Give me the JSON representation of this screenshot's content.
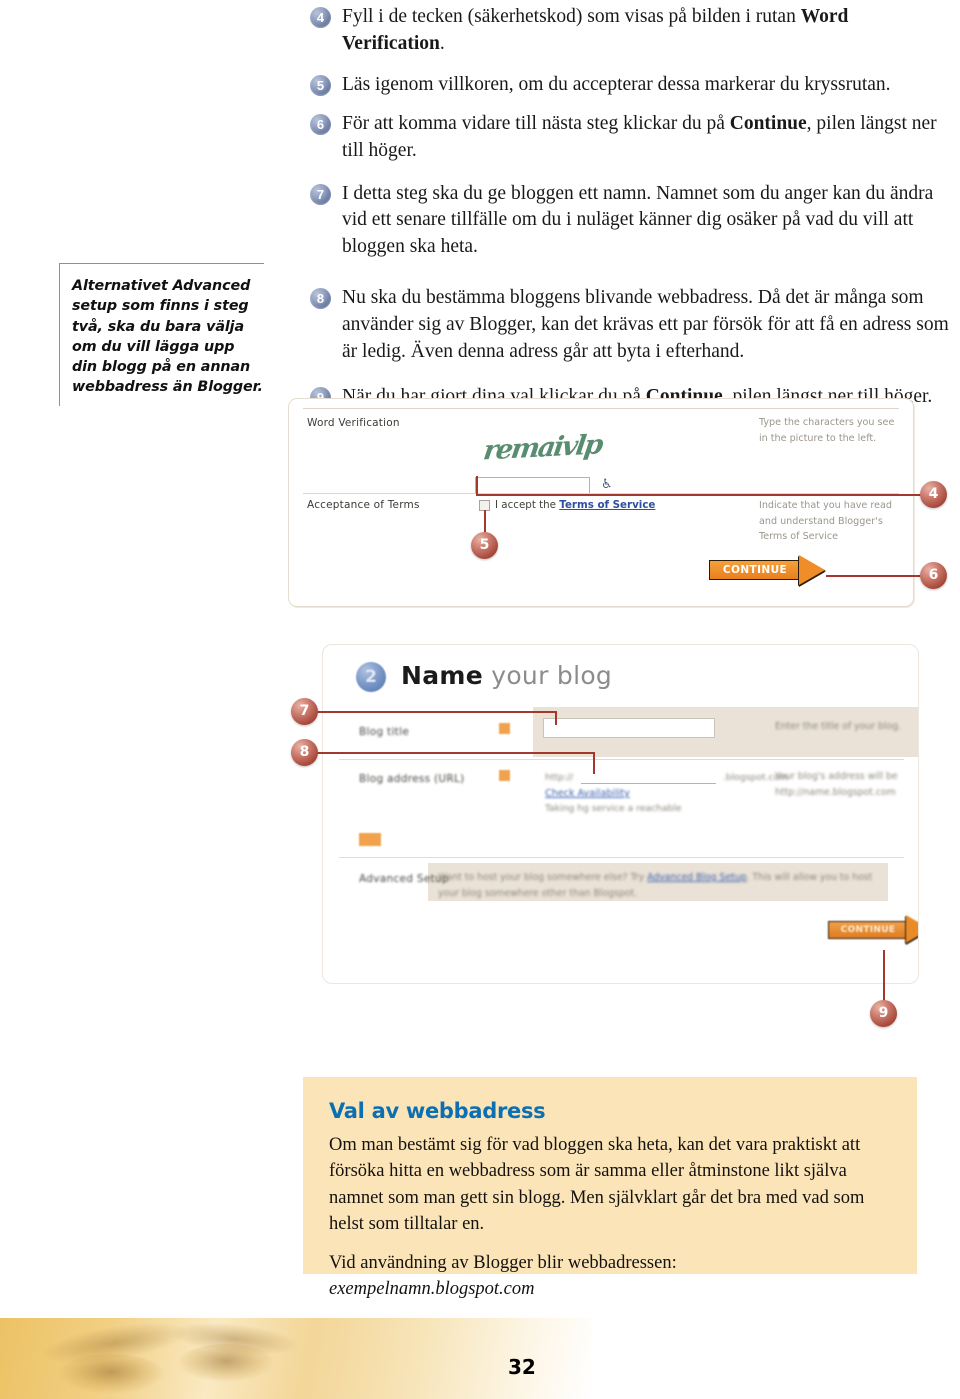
{
  "page": {
    "number": "32"
  },
  "steps": [
    {
      "num": "4",
      "parts": [
        {
          "t": "Fyll i de tecken (säkerhetskod) som visas på bilden i rutan ",
          "b": false
        },
        {
          "t": "Word Verification",
          "b": true
        },
        {
          "t": ".",
          "b": false
        }
      ]
    },
    {
      "num": "5",
      "parts": [
        {
          "t": "Läs igenom villkoren, om du accepterar dessa markerar du kryssrutan.",
          "b": false
        }
      ]
    },
    {
      "num": "6",
      "parts": [
        {
          "t": "För att komma vidare till nästa steg klickar du på ",
          "b": false
        },
        {
          "t": "Continue",
          "b": true
        },
        {
          "t": ", pilen längst ner till höger.",
          "b": false
        }
      ]
    },
    {
      "num": "7",
      "parts": [
        {
          "t": "I detta steg ska du ge bloggen ett namn. Namnet som du anger kan du ändra vid ett senare tillfälle om du i nuläget känner dig osäker på vad du vill att bloggen ska heta.",
          "b": false
        }
      ]
    },
    {
      "num": "8",
      "parts": [
        {
          "t": "Nu ska du bestämma bloggens blivande webbadress. Då det är många som använder sig av Blogger, kan det krävas ett par försök för att få en adress som är ledig. Även denna adress går att byta i efterhand.",
          "b": false
        }
      ]
    },
    {
      "num": "9",
      "parts": [
        {
          "t": "När du har gjort dina val klickar du på ",
          "b": false
        },
        {
          "t": "Continue",
          "b": true
        },
        {
          "t": ", pilen längst ner till höger.",
          "b": false
        }
      ]
    }
  ],
  "sidenote": {
    "text": "Alternativet Advanced setup som finns i steg två, ska du bara välja om du vill lägga upp din blogg på en annan webbadress än Blogger."
  },
  "figure1": {
    "row1_label": "Word Verification",
    "row1_help": "Type the characters you see in the picture to the left.",
    "captcha_text": "remaivlp",
    "captcha_input_value": "",
    "accessibility_icon": "wheelchair-icon",
    "row2_label": "Acceptance of Terms",
    "checkbox_label_prefix": "I accept the ",
    "checkbox_link": "Terms of Service",
    "row2_help": "Indicate that you have read and understand Blogger's Terms of Service",
    "continue_label": "CONTINUE"
  },
  "figure2": {
    "badge": "2",
    "title_bold": "Name",
    "title_rest": " your blog",
    "row_blog_title_label": "Blog title",
    "row_blog_title_value": "",
    "row_blog_title_help": "Enter the title of your blog.",
    "row_blog_address_label": "Blog address (URL)",
    "row_blog_address_prefix": "http://",
    "row_blog_address_suffix": ".blogspot.com",
    "check_availability_link": "Check Availability",
    "availability_note": "Taking hg service a reachable",
    "row_blog_address_help": "Your blog's address will be http://name.blogspot.com",
    "row_advanced_label": "Advanced Setup",
    "row_advanced_text_pre": "Want to host your blog somewhere else? Try ",
    "row_advanced_link": "Advanced Blog Setup",
    "row_advanced_text_post": ". This will allow you to host your blog somewhere other than Blogspot.",
    "continue_label": "CONTINUE"
  },
  "callouts": [
    {
      "id": "callout-4",
      "label": "4"
    },
    {
      "id": "callout-5",
      "label": "5"
    },
    {
      "id": "callout-6",
      "label": "6"
    },
    {
      "id": "callout-7",
      "label": "7"
    },
    {
      "id": "callout-8",
      "label": "8"
    },
    {
      "id": "callout-9",
      "label": "9"
    }
  ],
  "tipbox": {
    "heading": "Val av webbadress",
    "paragraph1": "Om man bestämt sig för vad bloggen ska heta, kan det vara praktiskt att försöka hitta en webbadress som är samma eller åtminstone likt själva namnet som man gett sin blogg. Men självklart går det bra med vad som helst som tilltalar en.",
    "paragraph2": "Vid användning av Blogger blir webbadressen:",
    "paragraph3": "exempelnamn.blogspot.com"
  },
  "colors": {
    "step_badge": "#5d6e96",
    "callout": "#a84a3c",
    "tip_heading": "#0b6fb4",
    "tip_background": "#fbe4b7",
    "continue_button": "#ef8d28",
    "captcha_green": "#3d7a58",
    "link_blue": "#2e4f9e"
  }
}
